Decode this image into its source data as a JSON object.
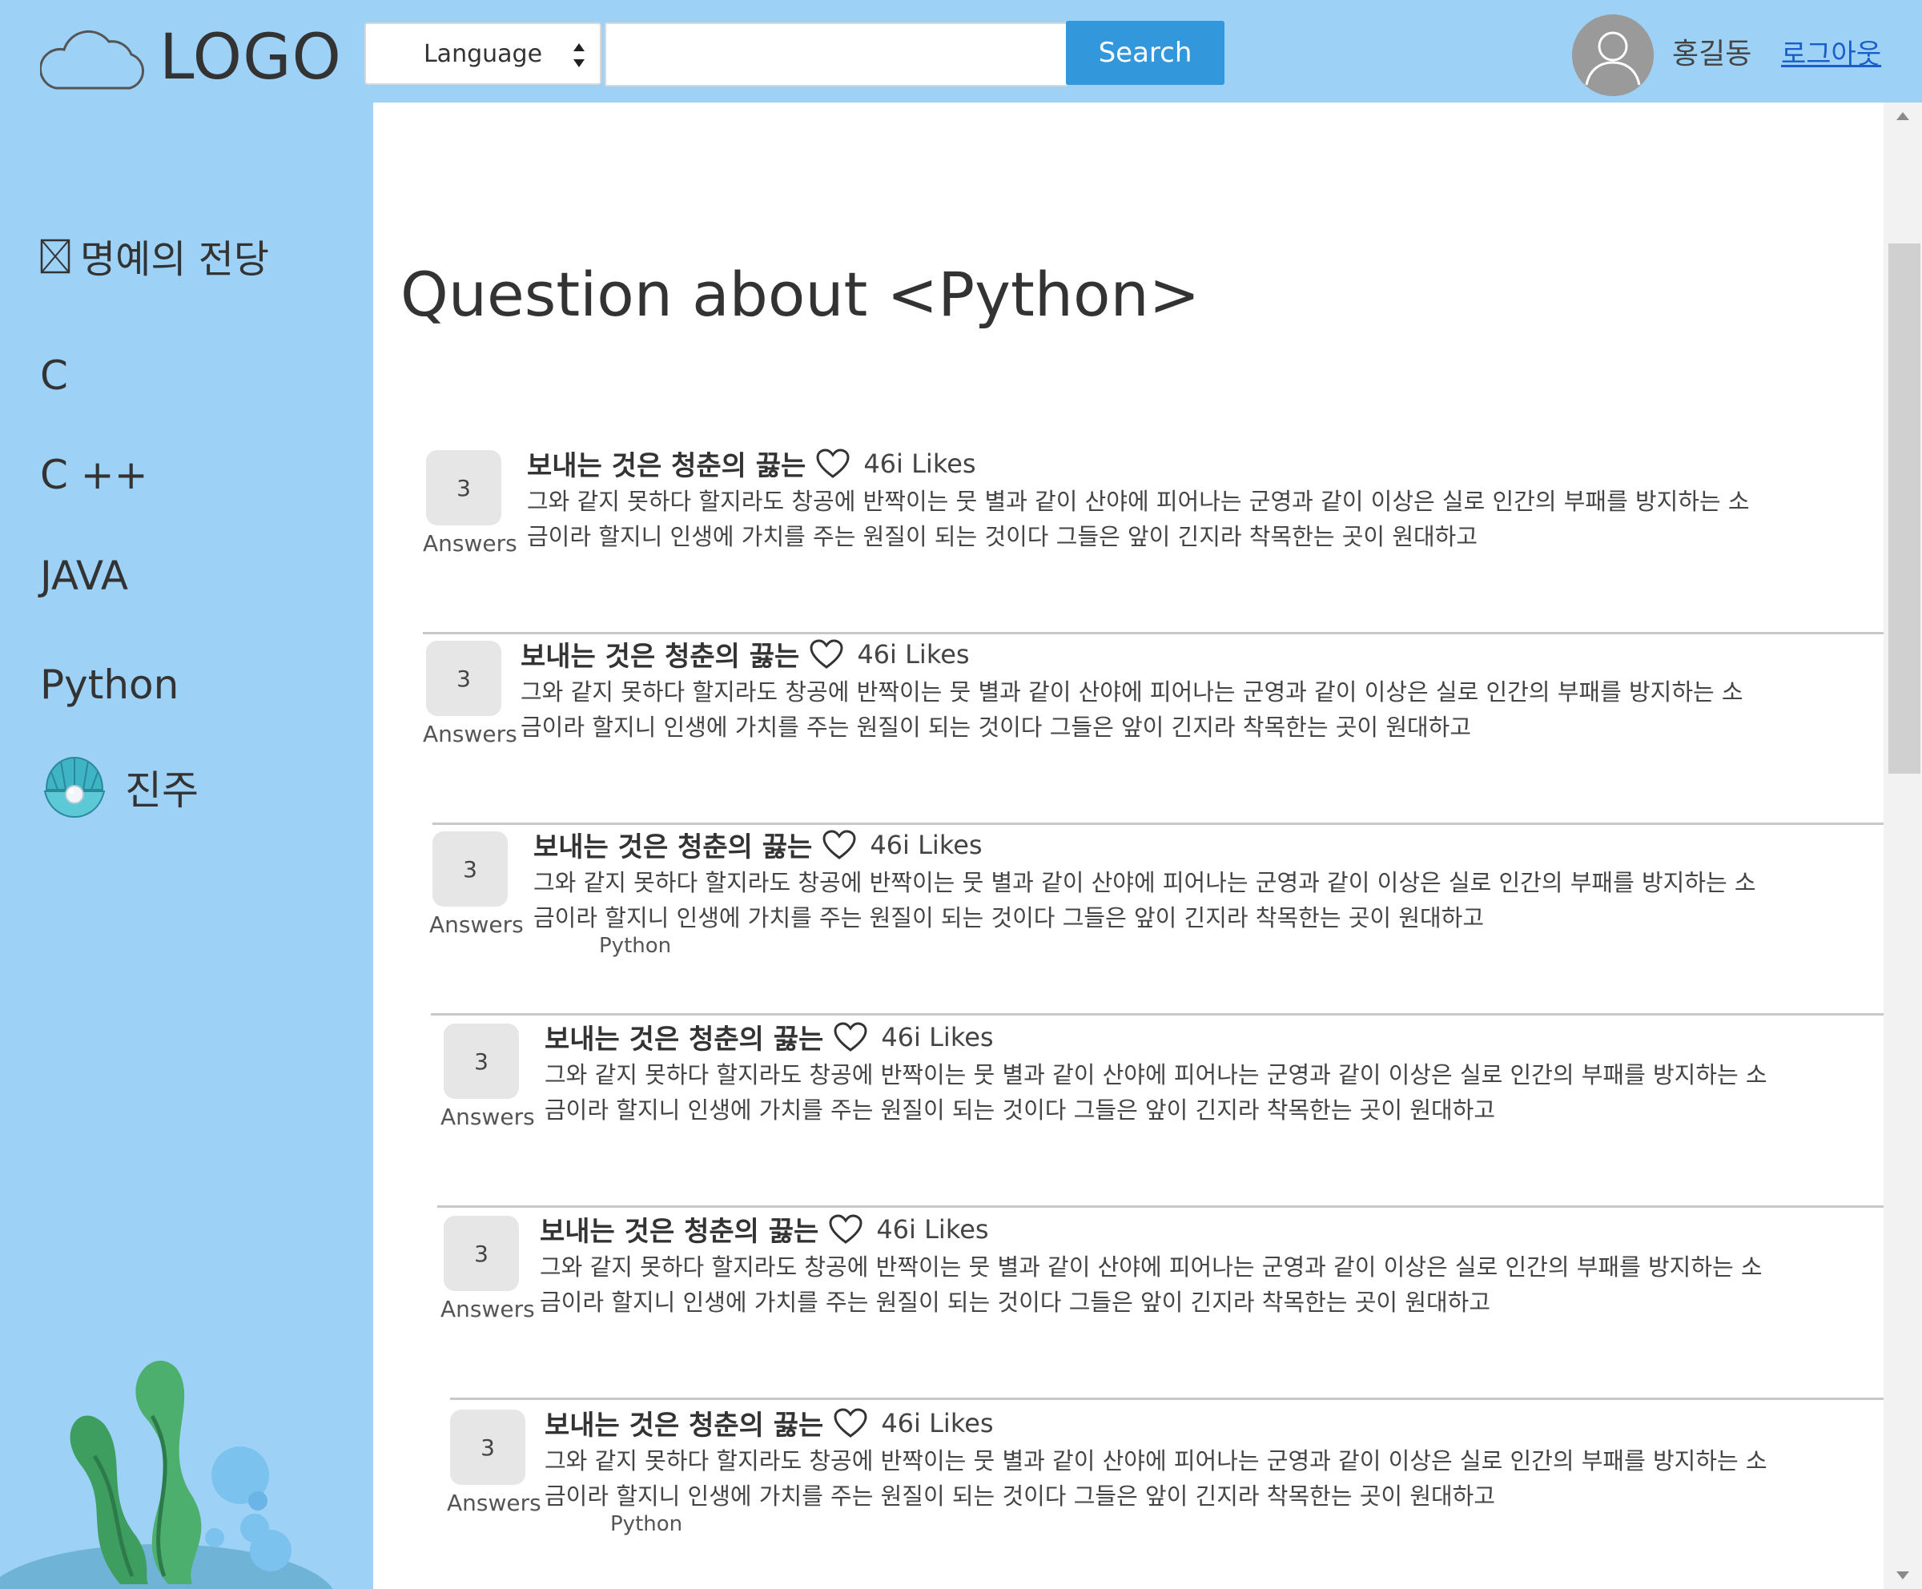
{
  "header": {
    "logo_text": "LOGO",
    "language_select": "Language",
    "search_placeholder": "",
    "search_button": "Search",
    "username": "홍길동",
    "logout": "로그아웃"
  },
  "sidebar": {
    "items": [
      {
        "label": "명예의 전당",
        "icon": "broken-image-icon"
      },
      {
        "label": "C"
      },
      {
        "label": "C ++"
      },
      {
        "label": "JAVA"
      },
      {
        "label": "Python"
      },
      {
        "label": "진주",
        "icon": "pearl-shell-icon"
      }
    ]
  },
  "main": {
    "title": "Question about <Python>",
    "questions": [
      {
        "answers": "3",
        "answers_label": "Answers",
        "title": "보내는 것은 청춘의 끓는",
        "likes": "46i Likes",
        "line1": "그와 같지 못하다 할지라도 창공에 반짝이는 뭇 별과 같이 산야에 피어나는 군영과 같이 이상은 실로 인간의 부패를 방지하는 소",
        "line2": "금이라 할지니 인생에 가치를 주는 원질이 되는 것이다 그들은 앞이 긴지라 착목한는 곳이 원대하고",
        "tag": ""
      },
      {
        "answers": "3",
        "answers_label": "Answers",
        "title": "보내는 것은 청춘의 끓는",
        "likes": "46i Likes",
        "line1": "그와 같지 못하다 할지라도 창공에 반짝이는 뭇 별과 같이 산야에 피어나는 군영과 같이 이상은 실로 인간의 부패를 방지하는 소",
        "line2": "금이라 할지니 인생에 가치를 주는 원질이 되는 것이다 그들은 앞이 긴지라 착목한는 곳이 원대하고",
        "tag": ""
      },
      {
        "answers": "3",
        "answers_label": "Answers",
        "title": "보내는 것은 청춘의 끓는",
        "likes": "46i Likes",
        "line1": "그와 같지 못하다 할지라도 창공에 반짝이는 뭇 별과 같이 산야에 피어나는 군영과 같이 이상은 실로 인간의 부패를 방지하는 소",
        "line2": "금이라 할지니 인생에 가치를 주는 원질이 되는 것이다 그들은 앞이 긴지라 착목한는 곳이 원대하고",
        "tag": "Python"
      },
      {
        "answers": "3",
        "answers_label": "Answers",
        "title": "보내는 것은 청춘의 끓는",
        "likes": "46i Likes",
        "line1": "그와 같지 못하다 할지라도 창공에 반짝이는 뭇 별과 같이 산야에 피어나는 군영과 같이 이상은 실로 인간의 부패를 방지하는 소",
        "line2": "금이라 할지니 인생에 가치를 주는 원질이 되는 것이다 그들은 앞이 긴지라 착목한는 곳이 원대하고",
        "tag": ""
      },
      {
        "answers": "3",
        "answers_label": "Answers",
        "title": "보내는 것은 청춘의 끓는",
        "likes": "46i Likes",
        "line1": "그와 같지 못하다 할지라도 창공에 반짝이는 뭇 별과 같이 산야에 피어나는 군영과 같이 이상은 실로 인간의 부패를 방지하는 소",
        "line2": "금이라 할지니 인생에 가치를 주는 원질이 되는 것이다 그들은 앞이 긴지라 착목한는 곳이 원대하고",
        "tag": ""
      },
      {
        "answers": "3",
        "answers_label": "Answers",
        "title": "보내는 것은 청춘의 끓는",
        "likes": "46i Likes",
        "line1": "그와 같지 못하다 할지라도 창공에 반짝이는 뭇 별과 같이 산야에 피어나는 군영과 같이 이상은 실로 인간의 부패를 방지하는 소",
        "line2": "금이라 할지니 인생에 가치를 주는 원질이 되는 것이다 그들은 앞이 긴지라 착목한는 곳이 원대하고",
        "tag": "Python"
      }
    ]
  },
  "colors": {
    "background": "#9dd1f5",
    "search_button": "#3397dc",
    "logout_link": "#1a5ec9",
    "seaweed": "#4caf6e",
    "bubble": "#7cc2ee"
  }
}
